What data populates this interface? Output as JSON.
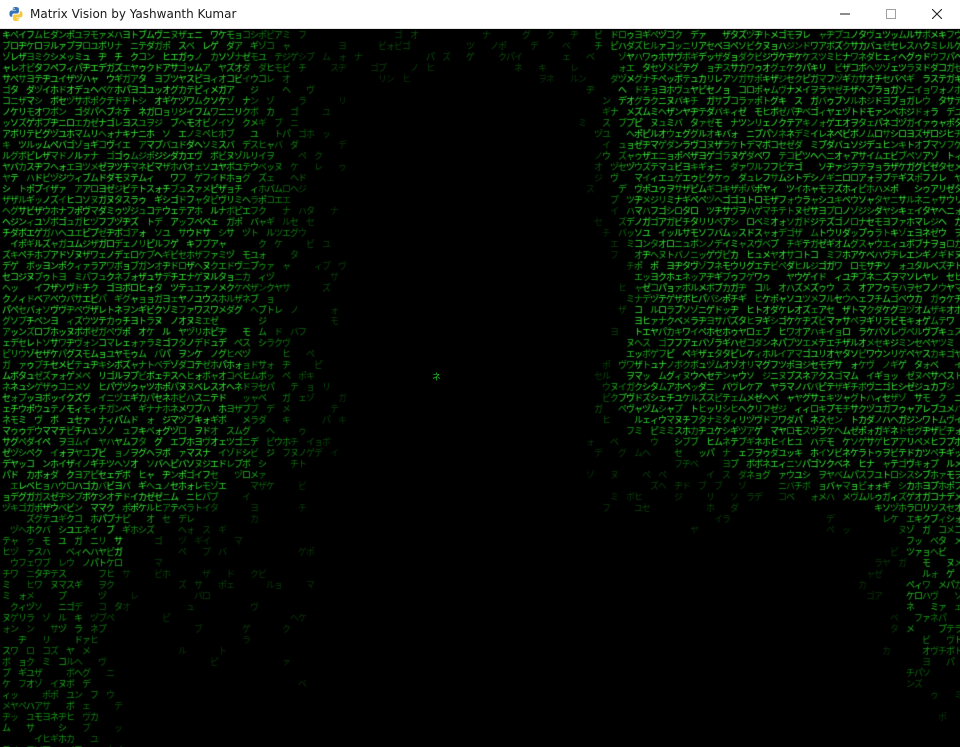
{
  "window": {
    "title": "Matrix Vision by Yashwanth Kumar",
    "app_icon": "python-icon",
    "controls": [
      "minimize-icon",
      "maximize-icon",
      "close-icon"
    ]
  },
  "matrix": {
    "glyph_color": "#2fdc2f",
    "dim_glyph_color": "#0d4a0d",
    "background_color": "#000000",
    "charset": "アァカサタナハマヤャラワガザダバパイィキシチニヒミリヂギジビピウゥクスツヌフムユュルグズブヅプエェケセテネヘメレゲゼデベペオォコソトノホモヨョロヲゴゾドボポヴッン",
    "center_glyph": "ネ"
  }
}
